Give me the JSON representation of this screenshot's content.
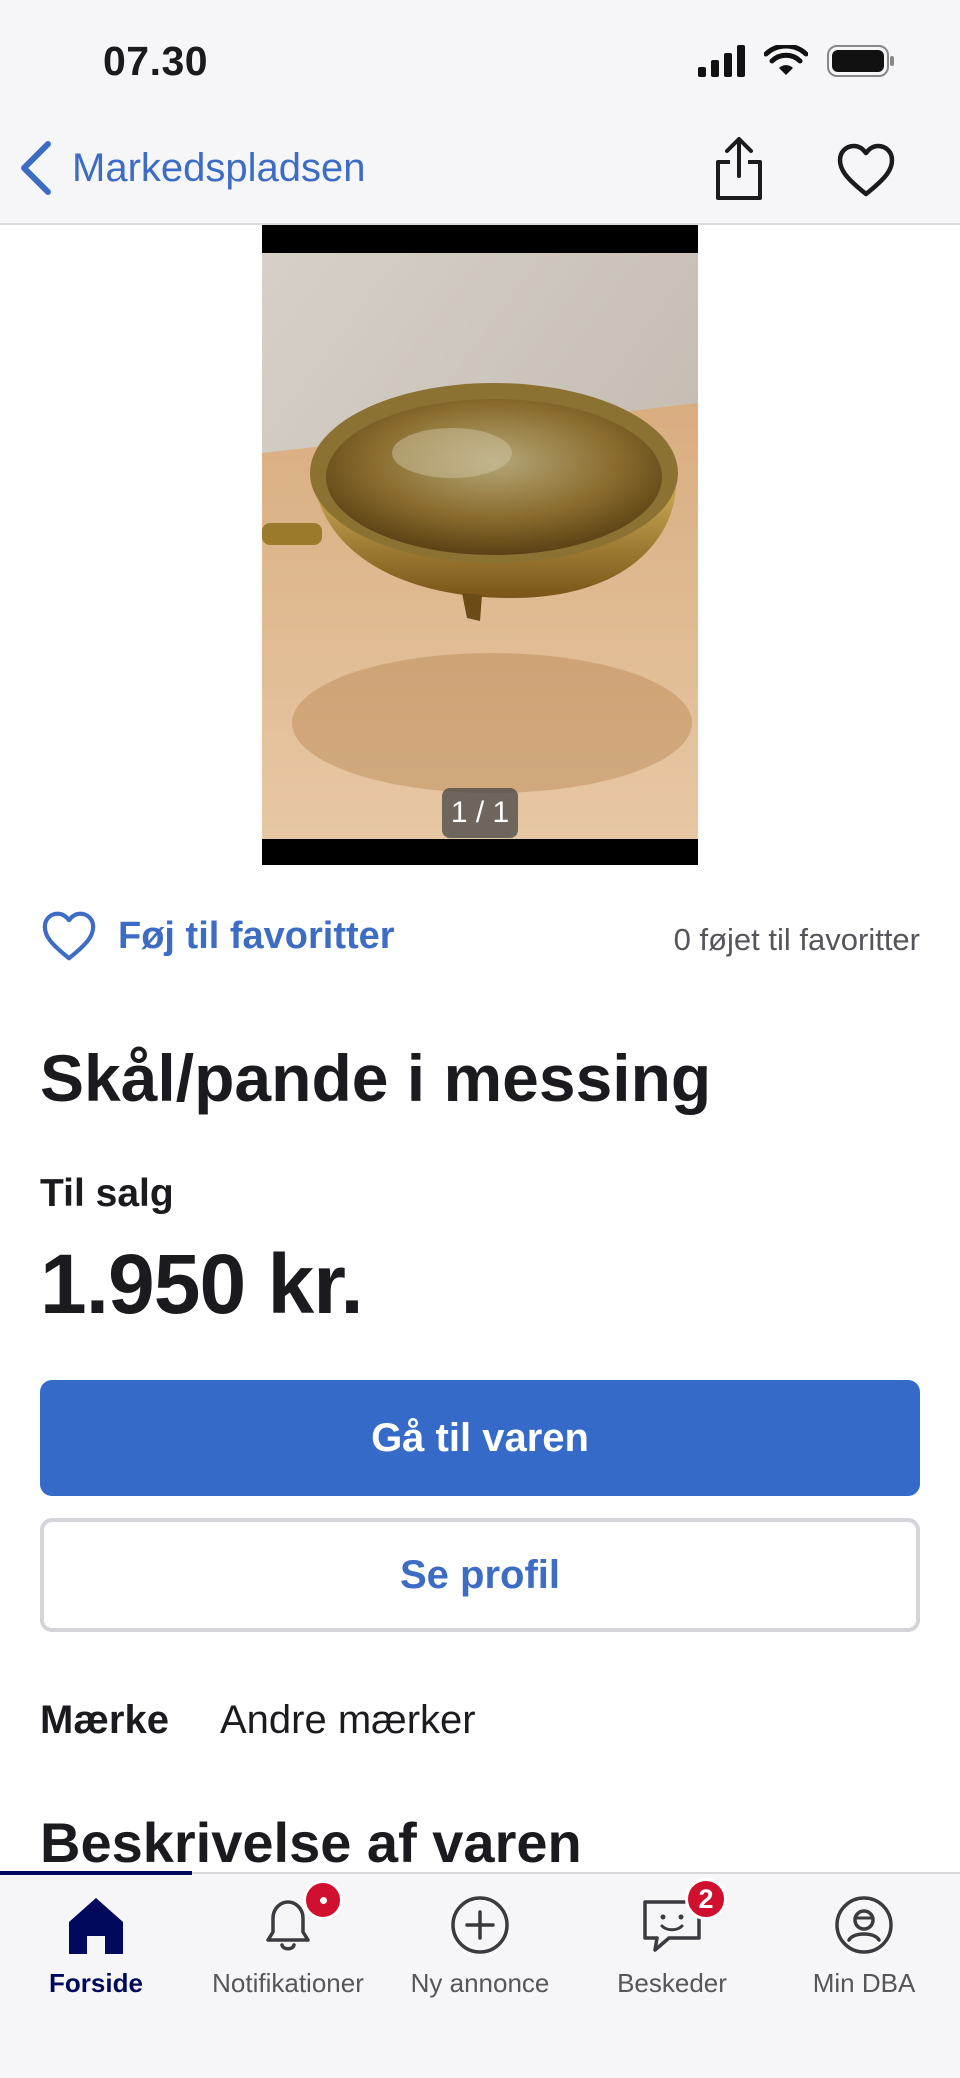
{
  "status_bar": {
    "time": "07.30"
  },
  "nav": {
    "back_label": "Markedspladsen"
  },
  "image": {
    "counter": "1 / 1"
  },
  "favorites": {
    "add_label": "Føj til favoritter",
    "count_label": "0 føjet til favoritter"
  },
  "listing": {
    "title": "Skål/pande i messing",
    "sale_type": "Til salg",
    "price": "1.950 kr."
  },
  "actions": {
    "primary": "Gå til varen",
    "secondary": "Se profil"
  },
  "attributes": [
    {
      "key": "Mærke",
      "value": "Andre mærker"
    }
  ],
  "section": {
    "description_title": "Beskrivelse af varen"
  },
  "tabs": [
    {
      "label": "Forside",
      "icon": "home-icon",
      "active": true
    },
    {
      "label": "Notifikationer",
      "icon": "bell-icon",
      "badge": "dot"
    },
    {
      "label": "Ny annonce",
      "icon": "plus-circle-icon"
    },
    {
      "label": "Beskeder",
      "icon": "chat-icon",
      "badge": "2"
    },
    {
      "label": "Min DBA",
      "icon": "profile-icon"
    }
  ],
  "colors": {
    "accent": "#356ac8",
    "link": "#3d6cc4",
    "tab_active": "#00095b",
    "badge": "#d0102e"
  }
}
